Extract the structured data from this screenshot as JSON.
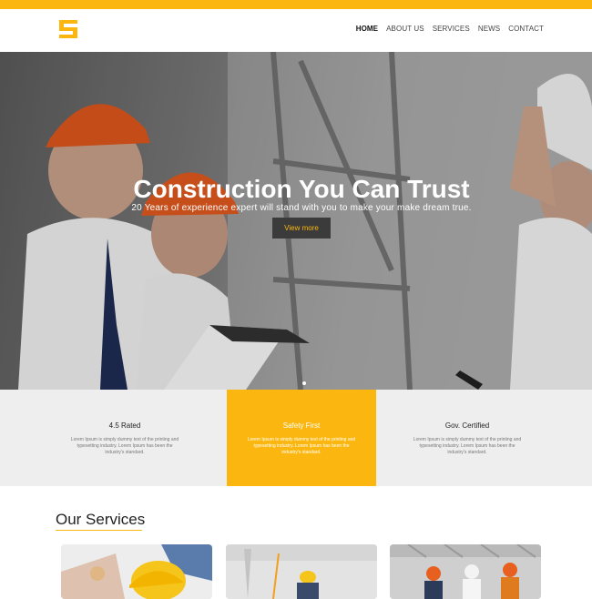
{
  "brand": {
    "logo_name": "S",
    "accent": "#fbb710"
  },
  "nav": {
    "items": [
      "HOME",
      "ABOUT US",
      "SERVICES",
      "NEWS",
      "CONTACT"
    ]
  },
  "hero": {
    "title": "Construction You Can Trust",
    "subtitle": "20 Years of experience expert will stand with you to make your make dream true.",
    "button": "View more"
  },
  "features": [
    {
      "title": "4.5 Rated",
      "text": "Lorem Ipsum is simply dummy text of the printing and typesetting industry. Lorem Ipsum has been the industry's standard."
    },
    {
      "title": "Safety First",
      "text": "Lorem Ipsum is simply dummy text of the printing and typesetting industry. Lorem Ipsum has been the industry's standard."
    },
    {
      "title": "Gov. Certified",
      "text": "Lorem Ipsum is simply dummy text of the printing and typesetting industry. Lorem Ipsum has been the industry's standard."
    }
  ],
  "services": {
    "title": "Our Services"
  }
}
